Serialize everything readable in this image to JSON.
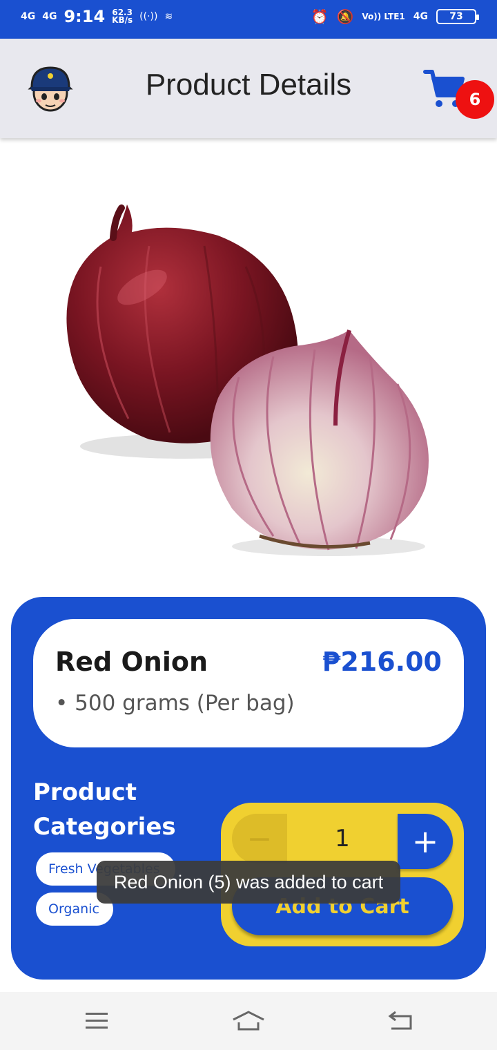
{
  "status_bar": {
    "signal_1": "4G",
    "signal_2": "4G",
    "time": "9:14",
    "speed_value": "62.3",
    "speed_unit": "KB/s",
    "volte": "Vo)) LTE1",
    "net": "4G",
    "battery": "73"
  },
  "header": {
    "title": "Product Details",
    "cart_count": "6"
  },
  "product": {
    "name": "Red Onion",
    "price": "₱216.00",
    "unit": "• 500 grams (Per bag)"
  },
  "categories": {
    "heading": "Product Categories",
    "items": [
      "Fresh Vegetables",
      "Organic"
    ]
  },
  "cart": {
    "minus": "−",
    "quantity": "1",
    "plus": "+",
    "add_label": "Add to Cart"
  },
  "toast": {
    "message": "Red Onion (5) was added to cart"
  },
  "colors": {
    "primary": "#1a50d0",
    "accent": "#f0d030",
    "badge": "#ee1111"
  },
  "icons": [
    "avatar",
    "cart-icon",
    "menu-icon",
    "home-icon",
    "back-icon"
  ]
}
